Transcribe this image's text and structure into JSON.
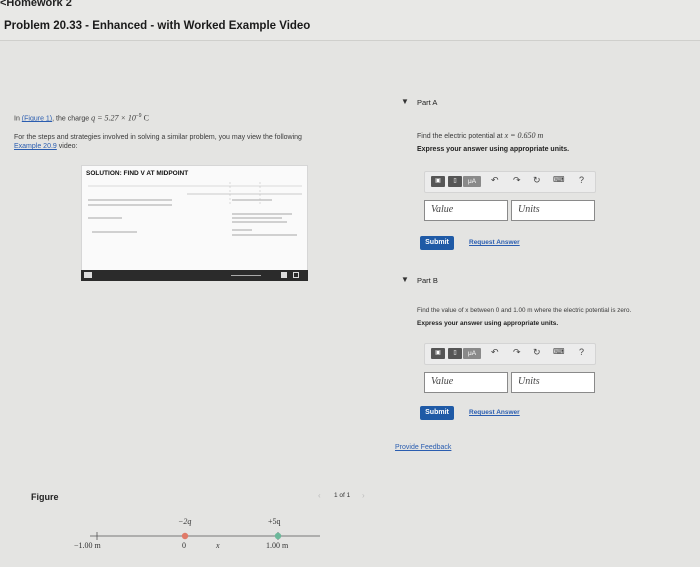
{
  "header": {
    "breadcrumb": "<Homework 2",
    "title": "Problem 20.33 - Enhanced - with Worked Example Video"
  },
  "problem": {
    "intro_prefix": "In",
    "figure_link": "(Figure 1)",
    "intro_rest": ", the charge",
    "charge_expr": "q = 5.27 × 10",
    "charge_exp": "−9",
    "charge_unit": " C",
    "steps_text": "For the steps and strategies involved in solving a similar problem, you may view the following",
    "example_link": "Example 20.9",
    "example_suffix": " video:"
  },
  "video": {
    "title": "SOLUTION: FIND V AT MIDPOINT"
  },
  "part_a": {
    "label": "Part A",
    "question_prefix": "Find the electric potential at",
    "question_value": "x = 0.650 m",
    "instruction": "Express your answer using appropriate units.",
    "value_placeholder": "Value",
    "units_placeholder": "Units",
    "submit_label": "Submit",
    "request_label": "Request Answer",
    "help_label": "?"
  },
  "part_b": {
    "label": "Part B",
    "question": "Find the value of x between 0 and 1.00 m where the electric potential is zero.",
    "instruction": "Express your answer using appropriate units.",
    "value_placeholder": "Value",
    "units_placeholder": "Units",
    "submit_label": "Submit",
    "request_label": "Request Answer",
    "help_label": "?"
  },
  "feedback": {
    "label": "Provide Feedback"
  },
  "figure": {
    "label": "Figure",
    "pager_text": "1 of 1",
    "charge_left_label": "−2q",
    "charge_right_label": "+5q",
    "tick_left": "−1.00 m",
    "tick_zero": "0",
    "tick_x": "x",
    "tick_right": "1.00 m",
    "colors": {
      "negative_charge": "#e07a68",
      "positive_charge": "#6cb89a"
    }
  },
  "toolbar": {
    "template_icon": "template-icon",
    "units_button": "μA",
    "undo_icon": "undo-icon",
    "redo_icon": "redo-icon",
    "reset_icon": "reset-icon",
    "keyboard_icon": "keyboard-icon"
  },
  "colors": {
    "submit_bg": "#1f5aa6",
    "link": "#2a5db0"
  }
}
